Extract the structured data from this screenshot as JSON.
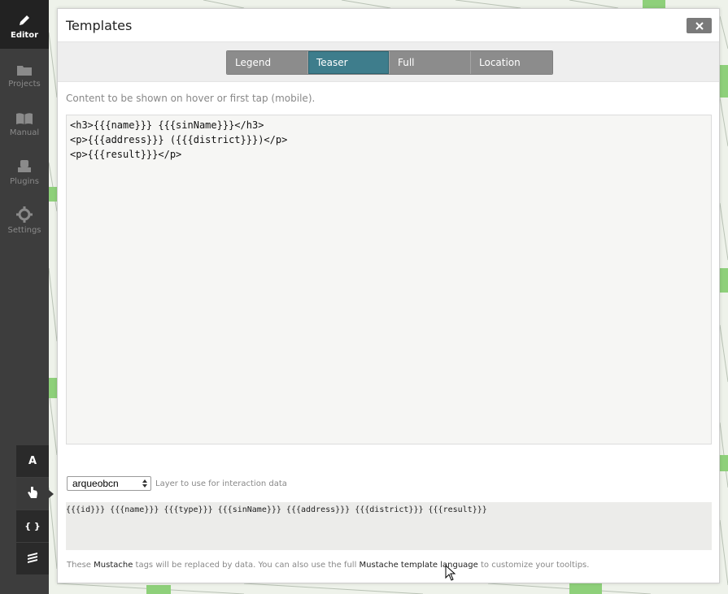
{
  "nav": {
    "items": [
      {
        "label": "Editor",
        "icon": "pencil-icon",
        "active": true
      },
      {
        "label": "Projects",
        "icon": "folder-icon",
        "active": false
      },
      {
        "label": "Manual",
        "icon": "book-icon",
        "active": false
      },
      {
        "label": "Plugins",
        "icon": "plugin-icon",
        "active": false
      },
      {
        "label": "Settings",
        "icon": "gear-icon",
        "active": false
      }
    ]
  },
  "tools": {
    "font_label": "A",
    "code_label": "{ }",
    "icons": [
      "font-icon",
      "hand-pointer-icon",
      "braces-icon",
      "layers-icon"
    ]
  },
  "modal": {
    "title": "Templates",
    "close_icon": "close-icon",
    "tabs": [
      {
        "label": "Legend",
        "active": false
      },
      {
        "label": "Teaser",
        "active": true
      },
      {
        "label": "Full",
        "active": false
      },
      {
        "label": "Location",
        "active": false
      }
    ],
    "description": "Content to be shown on hover or first tap (mobile).",
    "template_code": "<h3>{{{name}}} {{{sinName}}}</h3>\n<p>{{{address}}} ({{{district}}})</p>\n<p>{{{result}}}</p>",
    "layer_select": {
      "value": "arqueobcn"
    },
    "layer_label": "Layer to use for interaction data",
    "tags": "{{{id}}} {{{name}}} {{{type}}} {{{sinName}}} {{{address}}} {{{district}}} {{{result}}}",
    "footer": {
      "text1": "These ",
      "link1": "Mustache",
      "text2": " tags will be replaced by data. You can also use the full ",
      "link2": "Mustache template language",
      "text3": " to customize your tooltips."
    }
  },
  "colors": {
    "nav_bg": "#3d3d3d",
    "active_tab": "#3e7d8c",
    "tab": "#8c8c8c"
  }
}
